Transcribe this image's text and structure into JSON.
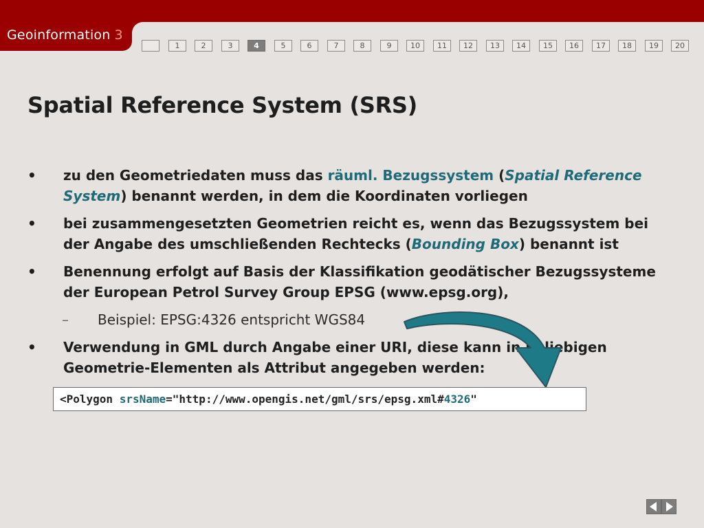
{
  "header": {
    "app_title": "Geoinformation",
    "app_number": "3"
  },
  "pagenav": {
    "pages": [
      "",
      "1",
      "2",
      "3",
      "4",
      "5",
      "6",
      "7",
      "8",
      "9",
      "10",
      "11",
      "12",
      "13",
      "14",
      "15",
      "16",
      "17",
      "18",
      "19",
      "20"
    ],
    "current": "4"
  },
  "slide": {
    "title": "Spatial Reference System (SRS)",
    "bullet_marker": "•",
    "sub_marker": "–",
    "b1": {
      "t1": "zu den Geometriedaten muss das ",
      "h1": "räuml. Bezugssystem",
      "t2": " (",
      "h2": "Spatial Reference",
      "h3": "System",
      "t3": ") benannt werden, in dem die Koordinaten vorliegen"
    },
    "b2": {
      "t1": "bei zusammengesetzten Geometrien reicht es, wenn das Bezugssystem bei",
      "t2": "der Angabe des umschließenden Rechtecks (",
      "h1": "Bounding Box",
      "t3": ") benannt ist"
    },
    "b3": {
      "t1": "Benennung erfolgt auf Basis der Klassifikation geodätischer Bezugssysteme",
      "t2": "der European Petrol Survey Group EPSG (www.epsg.org),"
    },
    "sub1": "Beispiel: EPSG:4326 entspricht WGS84",
    "b4": {
      "t1": "Verwendung in GML durch Angabe einer URI, diese kann in beliebigen",
      "t2": "Geometrie-Elementen als Attribut angegeben werden:"
    },
    "code": {
      "c1": "<Polygon ",
      "c2": "srsName",
      "c3": "=\"http://www.opengis.net/gml/srs/epsg.xml#",
      "c4": "4326",
      "c5": "\""
    }
  },
  "colors": {
    "header_red": "#9a0000",
    "accent_teal": "#1e6a78",
    "arrow_fill": "#1f7a88",
    "background": "#e6e2df"
  },
  "icons": {
    "prev": "triangle-left-icon",
    "next": "triangle-right-icon",
    "arrow": "curved-arrow-icon"
  }
}
